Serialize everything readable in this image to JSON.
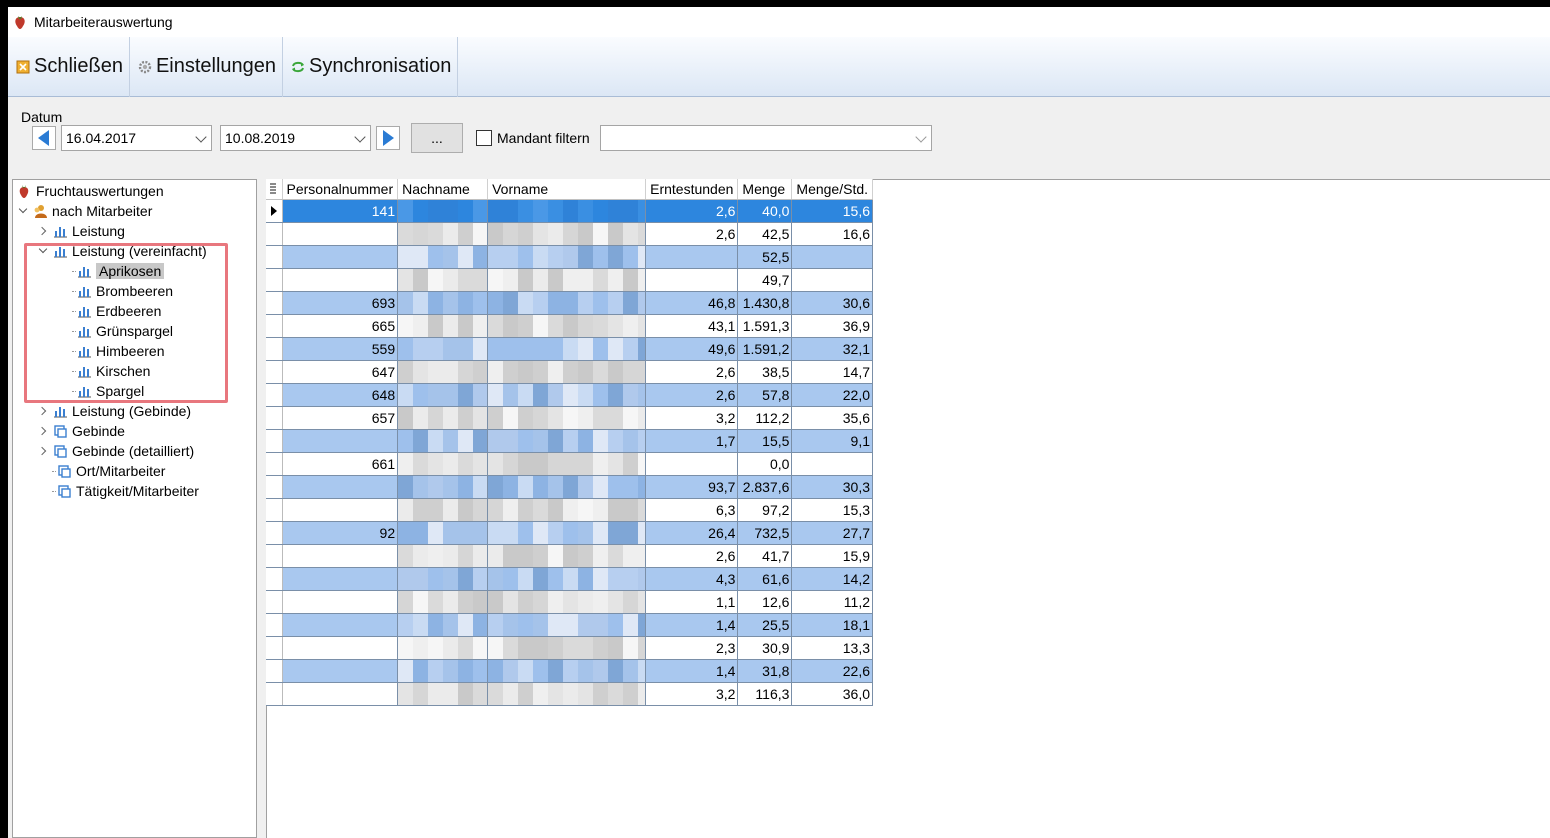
{
  "window": {
    "title": "Mitarbeiterauswertung"
  },
  "toolbar": {
    "close_label": "Schließen",
    "settings_label": "Einstellungen",
    "sync_label": "Synchronisation"
  },
  "filter": {
    "group_label": "Datum",
    "date_from": "16.04.2017",
    "date_to": "10.08.2019",
    "more_label": "...",
    "mandant_label": "Mandant filtern",
    "mandant_checked": false,
    "mandant_value": ""
  },
  "tree": {
    "root": "Fruchtauswertungen",
    "group": "nach Mitarbeiter",
    "items": [
      {
        "label": "Leistung"
      },
      {
        "label": "Leistung (vereinfacht)"
      },
      {
        "label": "Aprikosen"
      },
      {
        "label": "Brombeeren"
      },
      {
        "label": "Erdbeeren"
      },
      {
        "label": "Grünspargel"
      },
      {
        "label": "Himbeeren"
      },
      {
        "label": "Kirschen"
      },
      {
        "label": "Spargel"
      },
      {
        "label": "Leistung (Gebinde)"
      },
      {
        "label": "Gebinde"
      },
      {
        "label": "Gebinde (detailliert)"
      },
      {
        "label": "Ort/Mitarbeiter"
      },
      {
        "label": "Tätigkeit/Mitarbeiter"
      }
    ],
    "selected": "Aprikosen"
  },
  "grid": {
    "columns": [
      "Personalnummer",
      "Nachname",
      "Vorname",
      "Erntestunden",
      "Menge",
      "Menge/Std."
    ],
    "rows": [
      {
        "personalnummer": "141",
        "erntestunden": "2,6",
        "menge": "40,0",
        "menge_std": "15,6"
      },
      {
        "personalnummer": "",
        "erntestunden": "2,6",
        "menge": "42,5",
        "menge_std": "16,6"
      },
      {
        "personalnummer": "",
        "erntestunden": "",
        "menge": "52,5",
        "menge_std": ""
      },
      {
        "personalnummer": "",
        "erntestunden": "",
        "menge": "49,7",
        "menge_std": ""
      },
      {
        "personalnummer": "693",
        "erntestunden": "46,8",
        "menge": "1.430,8",
        "menge_std": "30,6"
      },
      {
        "personalnummer": "665",
        "erntestunden": "43,1",
        "menge": "1.591,3",
        "menge_std": "36,9"
      },
      {
        "personalnummer": "559",
        "erntestunden": "49,6",
        "menge": "1.591,2",
        "menge_std": "32,1"
      },
      {
        "personalnummer": "647",
        "erntestunden": "2,6",
        "menge": "38,5",
        "menge_std": "14,7"
      },
      {
        "personalnummer": "648",
        "erntestunden": "2,6",
        "menge": "57,8",
        "menge_std": "22,0"
      },
      {
        "personalnummer": "657",
        "erntestunden": "3,2",
        "menge": "112,2",
        "menge_std": "35,6"
      },
      {
        "personalnummer": "",
        "erntestunden": "1,7",
        "menge": "15,5",
        "menge_std": "9,1"
      },
      {
        "personalnummer": "661",
        "erntestunden": "",
        "menge": "0,0",
        "menge_std": ""
      },
      {
        "personalnummer": "",
        "erntestunden": "93,7",
        "menge": "2.837,6",
        "menge_std": "30,3"
      },
      {
        "personalnummer": "",
        "erntestunden": "6,3",
        "menge": "97,2",
        "menge_std": "15,3"
      },
      {
        "personalnummer": "92",
        "erntestunden": "26,4",
        "menge": "732,5",
        "menge_std": "27,7"
      },
      {
        "personalnummer": "",
        "erntestunden": "2,6",
        "menge": "41,7",
        "menge_std": "15,9"
      },
      {
        "personalnummer": "",
        "erntestunden": "4,3",
        "menge": "61,6",
        "menge_std": "14,2"
      },
      {
        "personalnummer": "",
        "erntestunden": "1,1",
        "menge": "12,6",
        "menge_std": "11,2"
      },
      {
        "personalnummer": "",
        "erntestunden": "1,4",
        "menge": "25,5",
        "menge_std": "18,1"
      },
      {
        "personalnummer": "",
        "erntestunden": "2,3",
        "menge": "30,9",
        "menge_std": "13,3"
      },
      {
        "personalnummer": "",
        "erntestunden": "1,4",
        "menge": "31,8",
        "menge_std": "22,6"
      },
      {
        "personalnummer": "",
        "erntestunden": "3,2",
        "menge": "116,3",
        "menge_std": "36,0"
      }
    ]
  },
  "colors": {
    "alt_row": "#a9c8ef",
    "selected_row": "#2d86de",
    "highlight_box": "#e8777e"
  }
}
